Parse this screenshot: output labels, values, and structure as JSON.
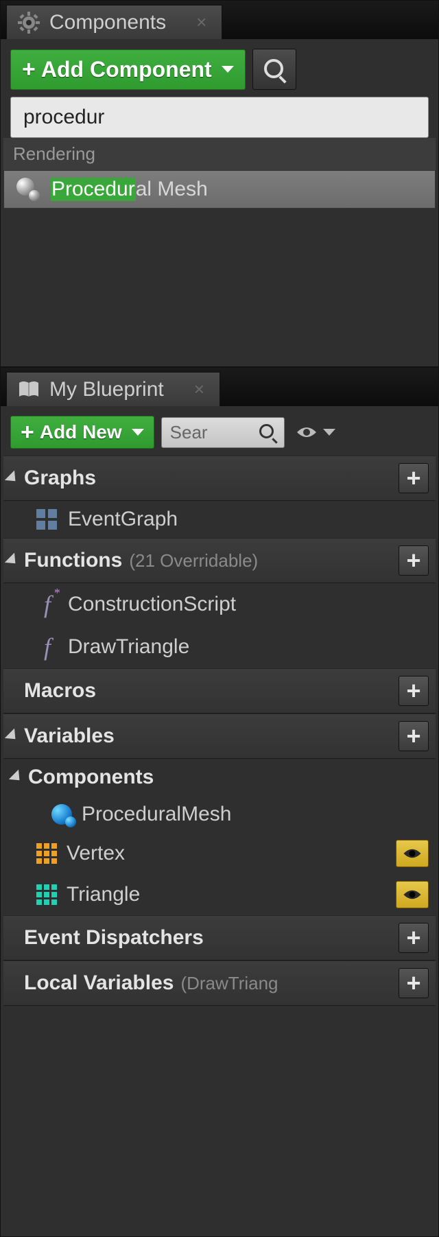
{
  "panels": {
    "components": {
      "tab_title": "Components",
      "add_button_label": "Add Component",
      "search_value": "procedur",
      "category_label": "Rendering",
      "result": {
        "highlight": "Procedur",
        "rest": "al Mesh"
      }
    },
    "myblueprint": {
      "tab_title": "My Blueprint",
      "add_button_label": "Add New",
      "search_placeholder": "Sear",
      "sections": {
        "graphs": {
          "label": "Graphs",
          "items": [
            {
              "label": "EventGraph"
            }
          ]
        },
        "functions": {
          "label": "Functions",
          "sub": "(21 Overridable)",
          "items": [
            {
              "label": "ConstructionScript"
            },
            {
              "label": "DrawTriangle"
            }
          ]
        },
        "macros": {
          "label": "Macros"
        },
        "variables": {
          "label": "Variables"
        },
        "components_sec": {
          "label": "Components",
          "items": [
            {
              "label": "ProceduralMesh"
            },
            {
              "label": "Vertex"
            },
            {
              "label": "Triangle"
            }
          ]
        },
        "event_dispatchers": {
          "label": "Event Dispatchers"
        },
        "local_vars": {
          "label": "Local Variables",
          "sub": "(DrawTriang"
        }
      }
    }
  }
}
